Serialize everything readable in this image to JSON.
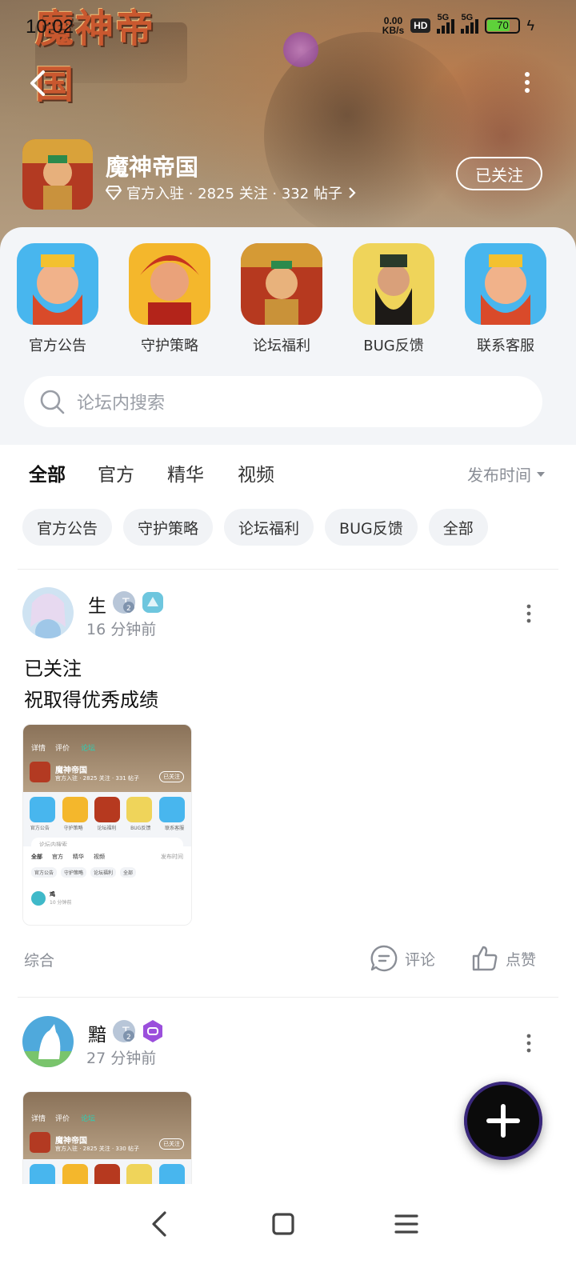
{
  "status_bar": {
    "time": "10:02",
    "net_speed_value": "0.00",
    "net_speed_unit": "KB/s",
    "hd": "HD",
    "signal1": "5G",
    "signal2": "5G",
    "battery": "70"
  },
  "header": {
    "game_logo_text": "魔神帝国",
    "forum_name": "魔神帝国",
    "meta": "官方入驻 · 2825 关注 · 332 帖子",
    "follow_label": "已关注"
  },
  "quick_links": [
    {
      "label": "官方公告",
      "color": "#3aa6e8"
    },
    {
      "label": "守护策略",
      "color": "#f5b62b"
    },
    {
      "label": "论坛福利",
      "color": "#c0422c"
    },
    {
      "label": "BUG反馈",
      "color": "#e9c33a"
    },
    {
      "label": "联系客服",
      "color": "#3aa6e8"
    }
  ],
  "search": {
    "placeholder": "论坛内搜索"
  },
  "tabs": [
    {
      "label": "全部",
      "active": true
    },
    {
      "label": "官方",
      "active": false
    },
    {
      "label": "精华",
      "active": false
    },
    {
      "label": "视频",
      "active": false
    }
  ],
  "sort_label": "发布时间",
  "chips": [
    "官方公告",
    "守护策略",
    "论坛福利",
    "BUG反馈",
    "全部"
  ],
  "posts": [
    {
      "username": "生",
      "time": "16 分钟前",
      "title_line1": "已关注",
      "title_line2": "祝取得优秀成绩",
      "category": "综合",
      "comment_label": "评论",
      "like_label": "点赞",
      "thumb": {
        "title": "魔神帝国",
        "meta": "官方入驻 · 2825 关注 · 331 帖子",
        "follow": "已关注",
        "links": [
          "官方公告",
          "守护策略",
          "论坛福利",
          "BUG反馈",
          "联系客服"
        ],
        "search": "论坛内搜索",
        "tabs": [
          "全部",
          "官方",
          "精华",
          "视频"
        ],
        "sort": "发布时间",
        "chips": [
          "官方公告",
          "守护策略",
          "论坛福利",
          "全部"
        ],
        "user": "鸡",
        "user_time": "10 分钟前",
        "nav": [
          "详情",
          "评价",
          "论坛"
        ]
      }
    },
    {
      "username": "黯",
      "time": "27 分钟前",
      "thumb": {
        "title": "魔神帝国",
        "meta": "官方入驻 · 2825 关注 · 330 帖子",
        "follow": "已关注",
        "nav": [
          "详情",
          "评价",
          "论坛"
        ]
      }
    }
  ],
  "colors": {
    "accent": "#2ad1b6",
    "muted": "#8a8e96",
    "chip_bg": "#f1f3f6"
  }
}
